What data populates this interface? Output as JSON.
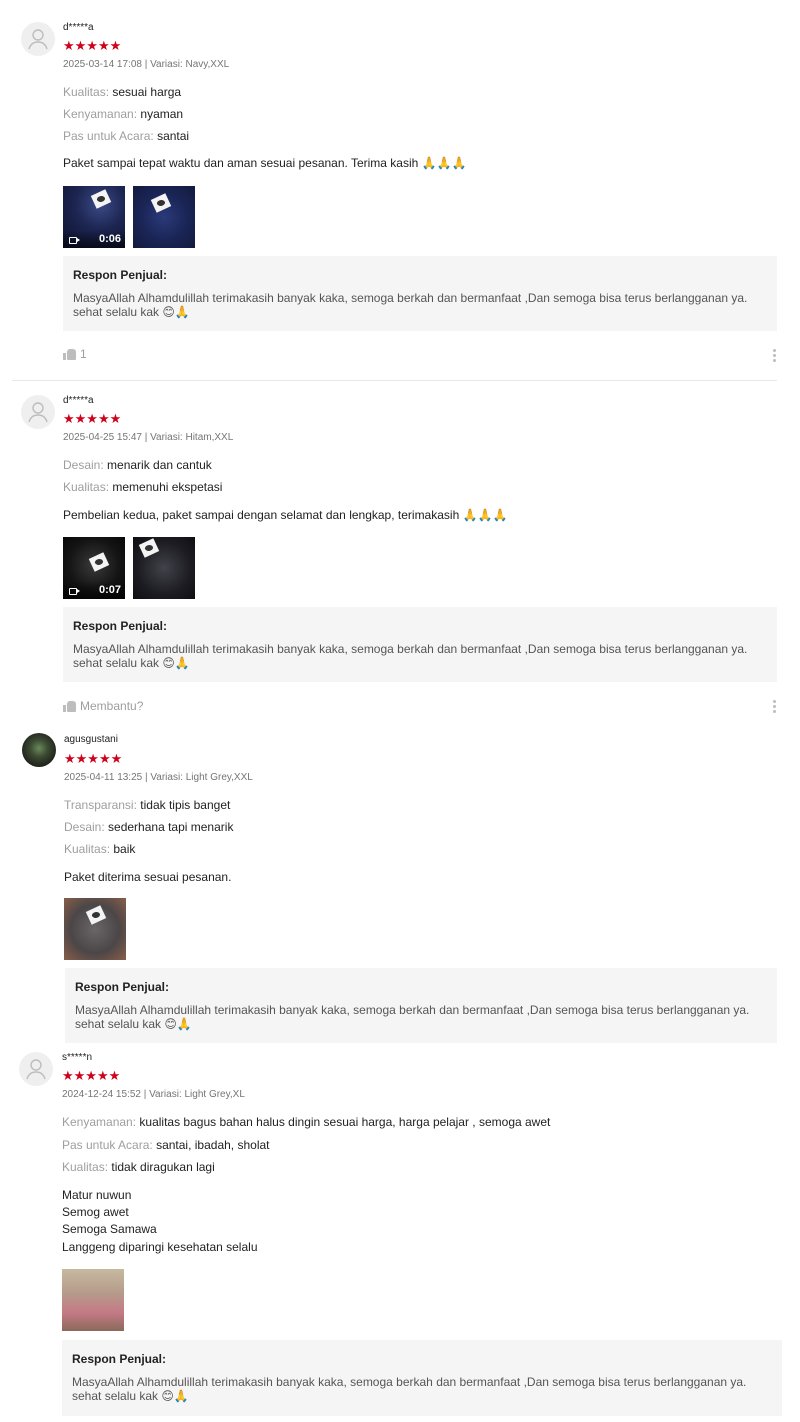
{
  "star_glyphs": "★★★★★",
  "reviews": [
    {
      "user": "d*****a",
      "meta": "2025-03-14 17:08 | Variasi: Navy,XXL",
      "attrs": [
        {
          "k": "Kualitas:",
          "v": "sesuai harga"
        },
        {
          "k": "Kenyamanan:",
          "v": "nyaman"
        },
        {
          "k": "Pas untuk Acara:",
          "v": "santai"
        }
      ],
      "comment": "Paket sampai tepat waktu dan aman sesuai pesanan. Terima kasih 🙏🙏🙏",
      "video_duration": "0:06",
      "response_title": "Respon Penjual:",
      "response_text": "MasyaAllah Alhamdulillah terimakasih banyak kaka, semoga berkah dan bermanfaat ,Dan semoga bisa terus berlangganan ya. sehat selalu kak 😊🙏",
      "likes": "1"
    },
    {
      "user": "d*****a",
      "meta": "2025-04-25 15:47 | Variasi: Hitam,XXL",
      "attrs": [
        {
          "k": "Desain:",
          "v": "menarik dan cantuk"
        },
        {
          "k": "Kualitas:",
          "v": "memenuhi ekspetasi"
        }
      ],
      "comment": "Pembelian kedua, paket sampai dengan selamat dan lengkap, terimakasih 🙏🙏🙏",
      "video_duration": "0:07",
      "response_title": "Respon Penjual:",
      "response_text": "MasyaAllah Alhamdulillah terimakasih banyak kaka, semoga berkah dan bermanfaat ,Dan semoga bisa terus berlangganan ya. sehat selalu kak 😊🙏",
      "helpful": "Membantu?"
    },
    {
      "user": "agusgustani",
      "meta": "2025-04-11 13:25 | Variasi: Light Grey,XXL",
      "attrs": [
        {
          "k": "Transparansi:",
          "v": "tidak tipis banget"
        },
        {
          "k": "Desain:",
          "v": "sederhana tapi menarik"
        },
        {
          "k": "Kualitas:",
          "v": "baik"
        }
      ],
      "comment": "Paket diterima sesuai pesanan.",
      "response_title": "Respon Penjual:",
      "response_text": "MasyaAllah Alhamdulillah terimakasih banyak kaka, semoga berkah dan bermanfaat ,Dan semoga bisa terus berlangganan ya. sehat selalu kak 😊🙏"
    },
    {
      "user": "s*****n",
      "meta": "2024-12-24 15:52 | Variasi: Light Grey,XL",
      "attrs": [
        {
          "k": "Kenyamanan:",
          "v": "kualitas bagus bahan halus dingin sesuai harga, harga pelajar , semoga awet"
        },
        {
          "k": "Pas untuk Acara:",
          "v": "santai, ibadah, sholat"
        },
        {
          "k": "Kualitas:",
          "v": "tidak diragukan lagi"
        }
      ],
      "comment_lines": [
        "Matur nuwun",
        "Semog awet",
        "Semoga Samawa",
        "Langgeng diparingi kesehatan selalu"
      ],
      "response_title": "Respon Penjual:",
      "response_text": "MasyaAllah Alhamdulillah terimakasih banyak kaka, semoga berkah dan bermanfaat ,Dan semoga bisa terus berlangganan ya. sehat selalu kak 😊🙏"
    }
  ]
}
